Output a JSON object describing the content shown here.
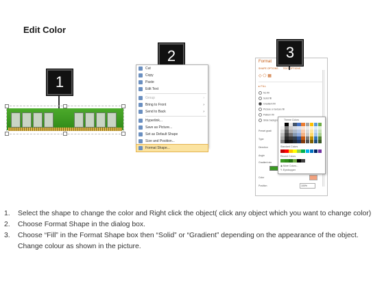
{
  "title": "Edit Color",
  "steps": [
    {
      "num": "1",
      "label": "1."
    },
    {
      "num": "2",
      "label": "2."
    },
    {
      "num": "3",
      "label": "3."
    }
  ],
  "context_menu": {
    "items": [
      {
        "label": "Cut",
        "icon": "cut-icon"
      },
      {
        "label": "Copy",
        "icon": "copy-icon"
      },
      {
        "label": "Paste",
        "icon": "paste-icon"
      },
      {
        "label": "Edit Text",
        "icon": "edit-text-icon"
      },
      {
        "label": "Group",
        "icon": "group-icon",
        "dim": true,
        "arrow": "›"
      },
      {
        "label": "Bring to Front",
        "icon": "bring-front-icon",
        "arrow": "›"
      },
      {
        "label": "Send to Back",
        "icon": "send-back-icon",
        "arrow": "›"
      },
      {
        "label": "Hyperlink...",
        "icon": "hyperlink-icon"
      },
      {
        "label": "Save as Picture...",
        "icon": "save-picture-icon"
      },
      {
        "label": "Set as Default Shape",
        "icon": "default-shape-icon"
      },
      {
        "label": "Size and Position...",
        "icon": "size-position-icon"
      },
      {
        "label": "Format Shape...",
        "icon": "format-shape-icon",
        "highlight": true
      }
    ]
  },
  "format_pane": {
    "title": "Format",
    "tabs": [
      "SHAPE OPTIONS",
      "TEXT OPTIONS"
    ],
    "section": "▸ FILL",
    "options": [
      "No fill",
      "Solid fill",
      "Gradient fill",
      "Picture or texture fill",
      "Pattern fill",
      "Slide background fill"
    ],
    "selected_option": 2,
    "rows": [
      "Preset gradi",
      "Type",
      "Direction",
      "Angle",
      "Gradient sto",
      "Color",
      "Position"
    ],
    "position_value": "100%",
    "palette": {
      "theme_label": "Theme Colors",
      "standard_label": "Standard Colors",
      "recent_label": "Recent Colors",
      "more_label": "More Colors...",
      "eyedropper_label": "Eyedropper"
    }
  },
  "instructions": [
    "Select the shape to change the color and Right click the object( click any object which you want to change color)",
    "Choose Format Shape in the dialog box.",
    "Choose “Fill” in the Format Shape box then “Solid” or “Gradient” depending on the appearance of the object. Change colour as shown in the picture."
  ],
  "colors": {
    "ram_green": "#3a9a22",
    "menu_highlight": "#fbe3a0",
    "pane_accent": "#c55a11"
  }
}
